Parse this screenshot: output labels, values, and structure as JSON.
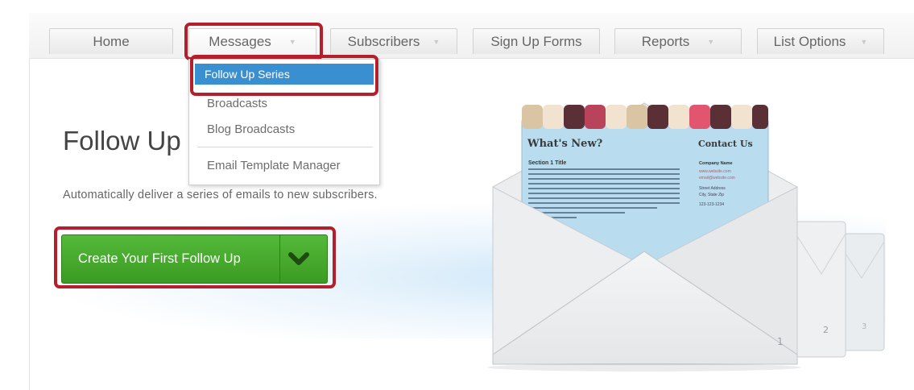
{
  "nav": {
    "tabs": [
      {
        "label": "Home",
        "has_caret": false
      },
      {
        "label": "Messages",
        "has_caret": true,
        "active": true
      },
      {
        "label": "Subscribers",
        "has_caret": true
      },
      {
        "label": "Sign Up Forms",
        "has_caret": false
      },
      {
        "label": "Reports",
        "has_caret": true
      },
      {
        "label": "List Options",
        "has_caret": true
      }
    ],
    "caret_glyph": "▼"
  },
  "dropdown": {
    "items": [
      {
        "label": "Follow Up Series",
        "selected": true
      },
      {
        "label": "Broadcasts"
      },
      {
        "label": "Blog Broadcasts"
      },
      {
        "label": "Email Template Manager"
      }
    ]
  },
  "page": {
    "title": "Follow Up",
    "subtitle": "Automatically deliver a series of emails to new subscribers.",
    "create_button_label": "Create Your First Follow Up"
  },
  "illustration": {
    "whats_new": "What's New?",
    "contact_us": "Contact Us",
    "section_title": "Section 1 Title",
    "company_name": "Company Name",
    "website": "www.website.com",
    "email": "email@website.com",
    "street": "Street Address",
    "city": "City, State Zip",
    "phone": "123-123-1234",
    "envelope_numbers": [
      "1",
      "2",
      "3"
    ]
  },
  "colors": {
    "accent_red": "#b51f2c",
    "menu_highlight": "#3a8fd0",
    "button_green": "#46a82c",
    "email_bg": "#b9dcef"
  }
}
